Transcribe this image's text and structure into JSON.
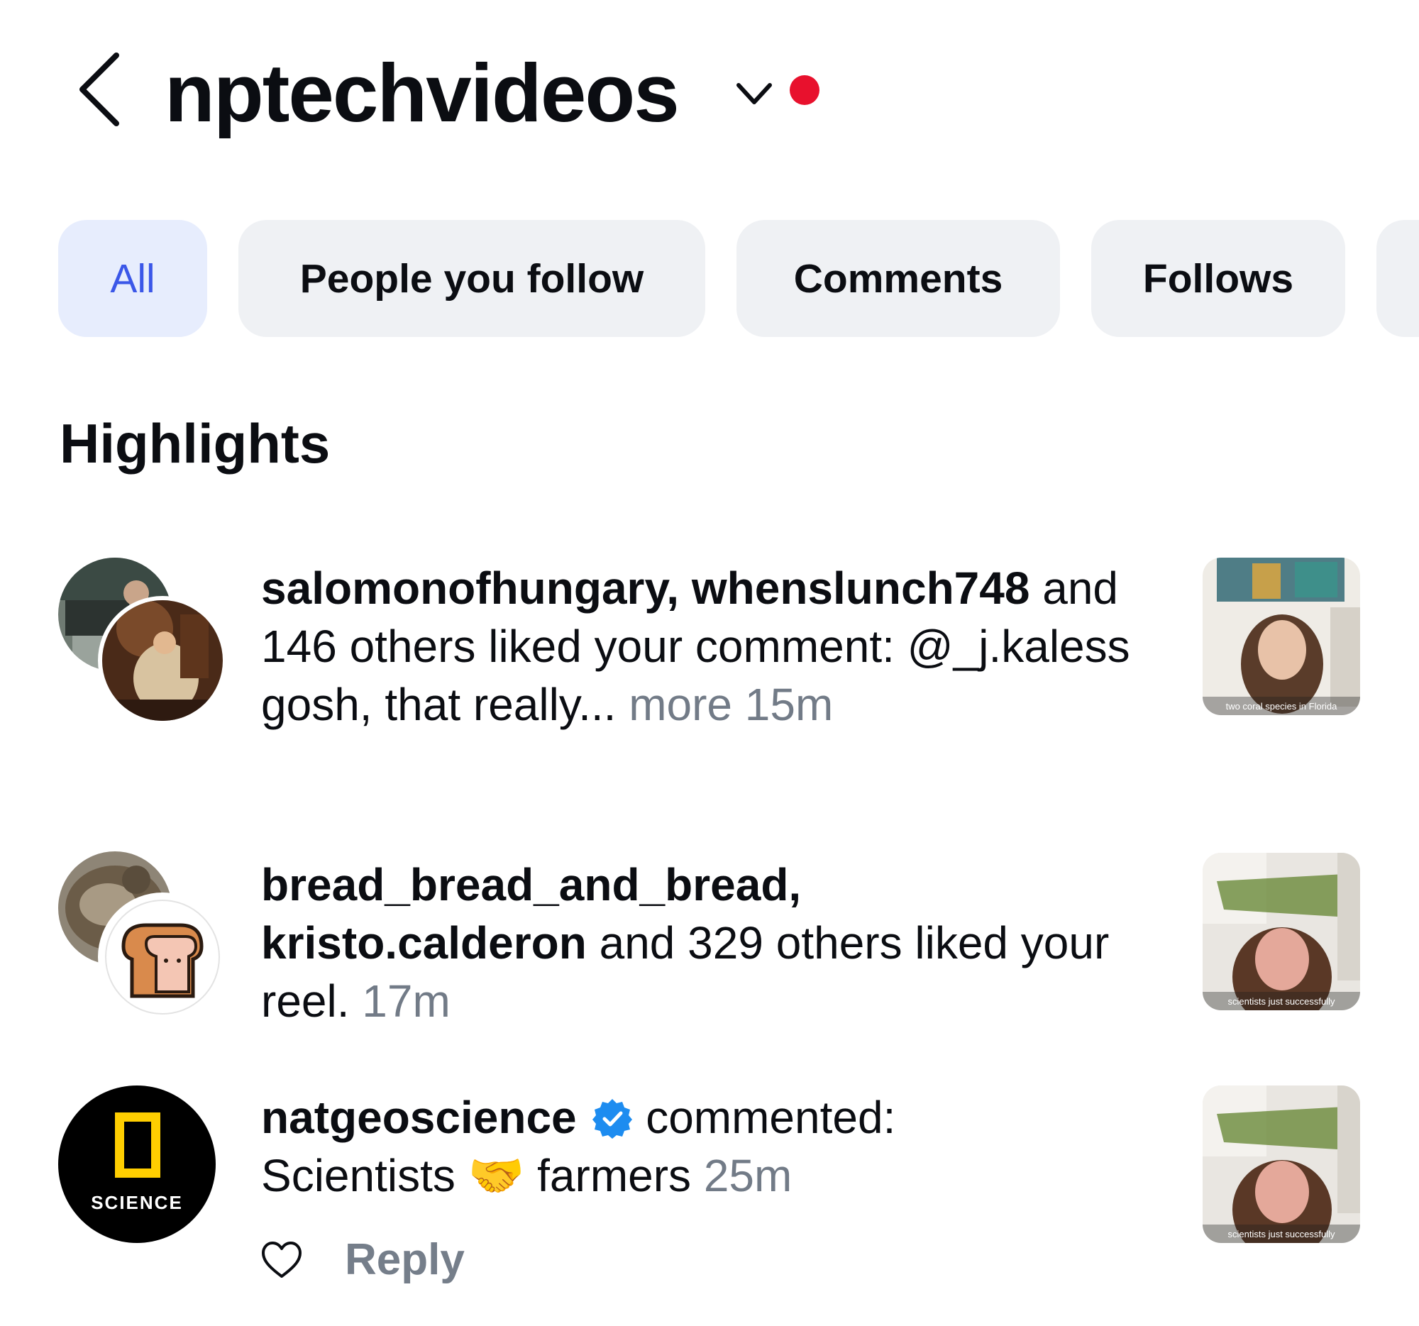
{
  "header": {
    "username": "nptechvideos",
    "back_icon": "chevron-left-icon",
    "switch_icon": "chevron-down-icon",
    "status_dot_color": "#e8112d"
  },
  "filters": [
    {
      "label": "All",
      "active": true
    },
    {
      "label": "People you follow",
      "active": false
    },
    {
      "label": "Comments",
      "active": false
    },
    {
      "label": "Follows",
      "active": false
    }
  ],
  "colors": {
    "active_chip_text": "#3b57e8",
    "active_chip_bg": "#e7edfd",
    "verified": "#1d8cf0"
  },
  "section_title": "Highlights",
  "notifications": [
    {
      "users": "salomonofhungary, whenslunch748",
      "action": " and 146 others liked your comment: @_j.kaless gosh, that really...",
      "more": " more",
      "time": " 15m",
      "thumb_caption": "two coral species in Florida"
    },
    {
      "users_line1": "bread_bread_and_bread,",
      "user2": "kristo.calderon",
      "action": " and 329 others liked your reel.",
      "time": " 17m",
      "thumb_caption": "scientists just successfully"
    },
    {
      "user": "natgeoscience",
      "action": " commented:",
      "comment": "Scientists 🤝 farmers",
      "time": " 25m",
      "avatar_text": "SCIENCE",
      "reply_label": "Reply",
      "thumb_caption": "scientists just successfully"
    }
  ]
}
